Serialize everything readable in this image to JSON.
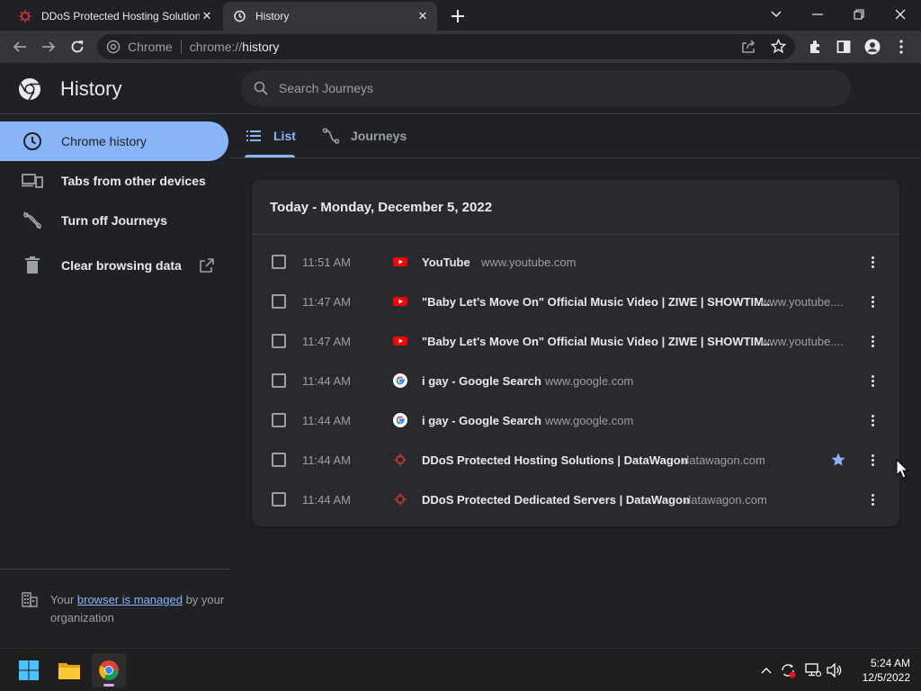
{
  "tabs": [
    {
      "title": "DDoS Protected Hosting Solution",
      "favicon": "datawagon-favicon"
    },
    {
      "title": "History",
      "favicon": "history-icon"
    }
  ],
  "omnibox": {
    "site": "Chrome",
    "url_prefix": "chrome://",
    "url_path": "history"
  },
  "page": {
    "title": "History",
    "search_placeholder": "Search Journeys"
  },
  "sidebar": {
    "items": [
      {
        "label": "Chrome history",
        "icon": "clock-icon"
      },
      {
        "label": "Tabs from other devices",
        "icon": "devices-icon"
      },
      {
        "label": "Turn off Journeys",
        "icon": "journeys-off-icon"
      },
      {
        "label": "Clear browsing data",
        "icon": "trash-icon"
      }
    ],
    "managed": {
      "prefix": "Your ",
      "link": "browser is managed",
      "suffix": " by your organization"
    }
  },
  "view_tabs": {
    "list": "List",
    "journeys": "Journeys"
  },
  "history": {
    "date_header": "Today - Monday, December 5, 2022",
    "entries": [
      {
        "time": "11:51 AM",
        "title": "YouTube",
        "domain": "www.youtube.com",
        "favicon": "youtube-favicon",
        "starred": false
      },
      {
        "time": "11:47 AM",
        "title": "\"Baby Let's Move On\" Official Music Video | ZIWE | SHOWTIM...",
        "domain": "www.youtube....",
        "favicon": "youtube-favicon",
        "starred": false
      },
      {
        "time": "11:47 AM",
        "title": "\"Baby Let's Move On\" Official Music Video | ZIWE | SHOWTIM...",
        "domain": "www.youtube....",
        "favicon": "youtube-favicon",
        "starred": false
      },
      {
        "time": "11:44 AM",
        "title": "i gay - Google Search",
        "domain": "www.google.com",
        "favicon": "google-favicon",
        "starred": false
      },
      {
        "time": "11:44 AM",
        "title": "i gay - Google Search",
        "domain": "www.google.com",
        "favicon": "google-favicon",
        "starred": false
      },
      {
        "time": "11:44 AM",
        "title": "DDoS Protected Hosting Solutions | DataWagon",
        "domain": "datawagon.com",
        "favicon": "datawagon-favicon",
        "starred": true
      },
      {
        "time": "11:44 AM",
        "title": "DDoS Protected Dedicated Servers | DataWagon",
        "domain": "datawagon.com",
        "favicon": "datawagon-favicon",
        "starred": false
      }
    ]
  },
  "taskbar": {
    "time": "5:24 AM",
    "date": "12/5/2022"
  },
  "colors": {
    "accent": "#8ab4f8",
    "background": "#202124",
    "card": "#292a2d",
    "toolbar": "#35363a"
  }
}
